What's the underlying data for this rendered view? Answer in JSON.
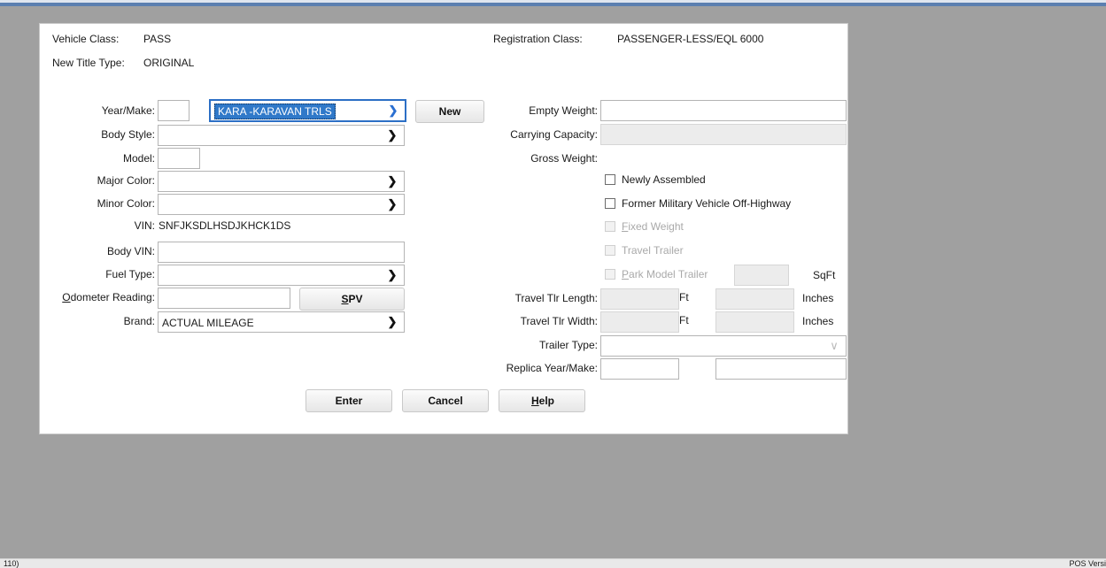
{
  "header": {
    "vehicle_class_label": "Vehicle Class:",
    "vehicle_class_value": "PASS",
    "registration_class_label": "Registration Class:",
    "registration_class_value": "PASSENGER-LESS/EQL 6000",
    "title_type_label": "New Title Type:",
    "title_type_value": "ORIGINAL"
  },
  "left": {
    "year_make_label": "Year/Make:",
    "year_value": "",
    "make_value": "KARA -KARAVAN TRLS",
    "new_button": "New",
    "body_style_label": "Body Style:",
    "body_style_value": "",
    "model_label": "Model:",
    "model_value": "",
    "major_color_label": "Major Color:",
    "major_color_value": "",
    "minor_color_label": "Minor Color:",
    "minor_color_value": "",
    "vin_label": "VIN:",
    "vin_value": "SNFJKSDLHSDJKHCK1DS",
    "body_vin_label": "Body VIN:",
    "body_vin_value": "",
    "fuel_type_label": "Fuel Type:",
    "fuel_type_value": "",
    "odometer_label_prefix": "O",
    "odometer_label_rest": "dometer Reading:",
    "odometer_value": "",
    "spv_prefix": "S",
    "spv_rest": "PV",
    "brand_label": "Brand:",
    "brand_value": "ACTUAL MILEAGE"
  },
  "right": {
    "empty_weight_label": "Empty Weight:",
    "empty_weight_value": "",
    "carrying_capacity_label": "Carrying Capacity:",
    "carrying_capacity_value": "",
    "gross_weight_label": "Gross Weight:",
    "newly_assembled": "Newly Assembled",
    "former_military": "Former Military Vehicle Off-Highway",
    "fixed_weight_prefix": "F",
    "fixed_weight_rest": "ixed Weight",
    "travel_trailer": "Travel Trailer",
    "park_model_prefix": "P",
    "park_model_rest": "ark Model Trailer",
    "sqft_label": "SqFt",
    "travel_length_label": "Travel Tlr Length:",
    "travel_width_label": "Travel Tlr Width:",
    "ft_label": "Ft",
    "inches_label": "Inches",
    "trailer_type_label": "Trailer Type:",
    "trailer_type_value": "",
    "replica_label": "Replica Year/Make:"
  },
  "buttons": {
    "enter": "Enter",
    "cancel": "Cancel",
    "help_prefix": "H",
    "help_rest": "elp"
  },
  "footer": {
    "left_text": "110)",
    "right_text": "POS Versi"
  },
  "colors": {
    "background": "#a0a0a0",
    "panel": "#ffffff",
    "selection": "#3079c9",
    "focus_border": "#2c6fc5"
  }
}
